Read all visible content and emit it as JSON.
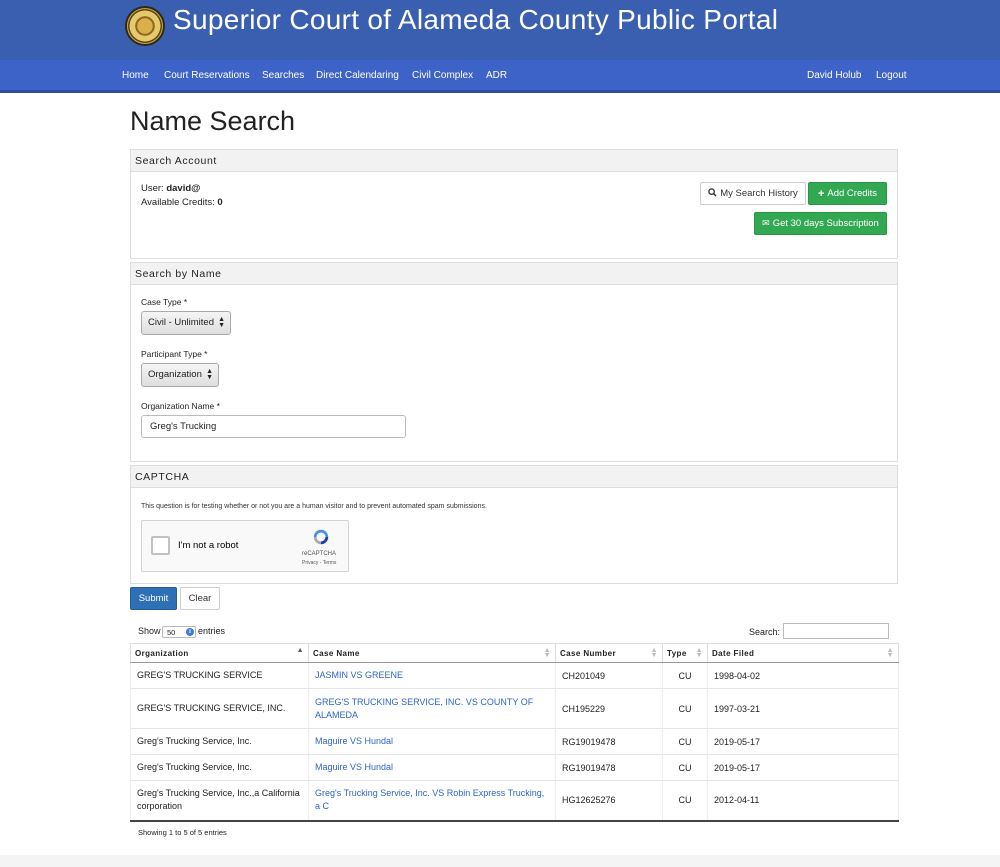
{
  "header": {
    "title": "Superior Court of Alameda County Public Portal",
    "colors": {
      "banner": "#3b5fb0",
      "nav": "#3d62c8"
    }
  },
  "nav": {
    "items": [
      "Home",
      "Court Reservations",
      "Searches",
      "Direct Calendaring",
      "Civil Complex",
      "ADR"
    ],
    "user": "David Holub",
    "logout": "Logout"
  },
  "page": {
    "heading": "Name Search"
  },
  "account": {
    "panel_title": "Search Account",
    "user_label": "User:",
    "user_value": "david@",
    "credits_label": "Available Credits:",
    "credits_value": "0",
    "history_button": "My Search History",
    "add_credits_button": "Add Credits",
    "subscription_button": "Get 30 days Subscription"
  },
  "search": {
    "panel_title": "Search by Name",
    "case_type_label": "Case Type",
    "case_type_value": "Civil - Unlimited",
    "participant_type_label": "Participant Type",
    "participant_type_value": "Organization",
    "org_name_label": "Organization Name",
    "org_name_value": "Greg's Trucking",
    "required_mark": "*"
  },
  "captcha": {
    "panel_title": "CAPTCHA",
    "note": "This question is for testing whether or not you are a human visitor and to prevent automated spam submissions.",
    "checkbox_label": "I'm not a robot",
    "brand": "reCAPTCHA",
    "terms": "Privacy - Terms"
  },
  "actions": {
    "submit": "Submit",
    "clear": "Clear"
  },
  "table": {
    "show_label": "Show",
    "page_length": "50",
    "entries_label": "entries",
    "search_label": "Search:",
    "columns": [
      "Organization",
      "Case Name",
      "Case Number",
      "Type",
      "Date Filed"
    ],
    "rows": [
      {
        "org": "GREG'S TRUCKING SERVICE",
        "case_name": "JASMIN VS GREENE",
        "case_number": "CH201049",
        "type": "CU",
        "date": "1998-04-02"
      },
      {
        "org": "GREG'S TRUCKING SERVICE, INC.",
        "case_name": "GREG'S TRUCKING SERVICE, INC. VS COUNTY OF ALAMEDA",
        "case_number": "CH195229",
        "type": "CU",
        "date": "1997-03-21"
      },
      {
        "org": "Greg's Trucking Service, Inc.",
        "case_name": "Maguire VS Hundal",
        "case_number": "RG19019478",
        "type": "CU",
        "date": "2019-05-17"
      },
      {
        "org": "Greg's Trucking Service, Inc.",
        "case_name": "Maguire VS Hundal",
        "case_number": "RG19019478",
        "type": "CU",
        "date": "2019-05-17"
      },
      {
        "org": "Greg's Trucking Service, Inc.,a California corporation",
        "case_name": "Greg's Trucking Service, Inc. VS Robin Express Trucking, a C",
        "case_number": "HG12625276",
        "type": "CU",
        "date": "2012-04-11"
      }
    ],
    "info": "Showing 1 to 5 of 5 entries"
  }
}
